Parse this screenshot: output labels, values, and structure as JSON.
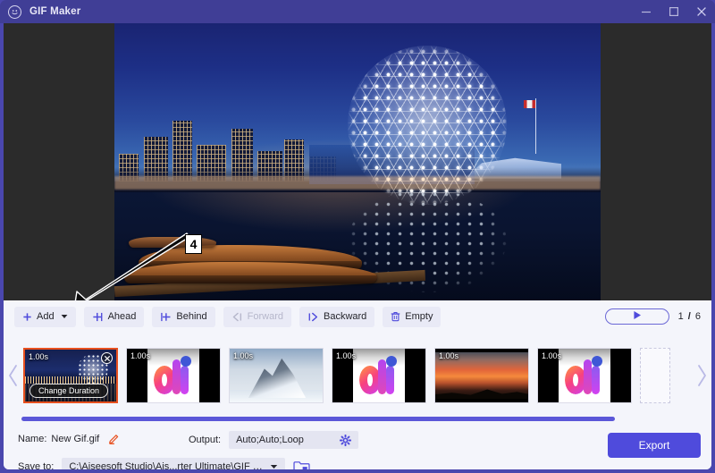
{
  "window": {
    "title": "GIF Maker",
    "logo_icon": "smiley-circle-icon",
    "minimize_icon": "minimize-icon",
    "maximize_icon": "maximize-icon",
    "close_icon": "close-icon",
    "titlebar_color": "#403e96",
    "accent_color": "#4f4bdc"
  },
  "annotation": {
    "step_number": "4",
    "arrow_icon": "arrow-down-left-icon"
  },
  "preview": {
    "name": "gif-preview-frame",
    "description": "Science World geodesic dome night cityscape"
  },
  "toolbar": {
    "add_label": "Add",
    "add_icon": "plus-icon",
    "add_caret_icon": "chevron-down-icon",
    "ahead_label": "Ahead",
    "ahead_icon": "insert-ahead-icon",
    "behind_label": "Behind",
    "behind_icon": "insert-behind-icon",
    "forward_label": "Forward",
    "forward_icon": "move-forward-icon",
    "forward_disabled": true,
    "backward_label": "Backward",
    "backward_icon": "move-backward-icon",
    "empty_label": "Empty",
    "empty_icon": "trash-icon",
    "play_icon": "play-icon",
    "counter_current": "1",
    "counter_separator": "/",
    "counter_total": "6"
  },
  "filmstrip": {
    "prev_icon": "chevron-left-icon",
    "next_icon": "chevron-right-icon",
    "selected_index": 0,
    "selected_border_color": "#e8501f",
    "close_icon": "close-circle-icon",
    "tooltip": "Change Duration",
    "add_placeholder_name": "add-frame-placeholder",
    "frames": [
      {
        "duration": "1.00s",
        "kind": "city"
      },
      {
        "duration": "1.00s",
        "kind": "ai"
      },
      {
        "duration": "1.00s",
        "kind": "snow"
      },
      {
        "duration": "1.00s",
        "kind": "ai"
      },
      {
        "duration": "1.00s",
        "kind": "sunset"
      },
      {
        "duration": "1.00s",
        "kind": "ai"
      }
    ]
  },
  "form": {
    "name_label": "Name:",
    "name_value": "New Gif.gif",
    "edit_icon": "pencil-icon",
    "output_label": "Output:",
    "output_value": "Auto;Auto;Loop",
    "settings_icon": "gear-icon",
    "save_label": "Save to:",
    "save_value": "C:\\Aiseesoft Studio\\Ais...rter Ultimate\\GIF Maker",
    "save_caret_icon": "chevron-down-icon",
    "browse_icon": "folder-icon",
    "export_label": "Export"
  }
}
